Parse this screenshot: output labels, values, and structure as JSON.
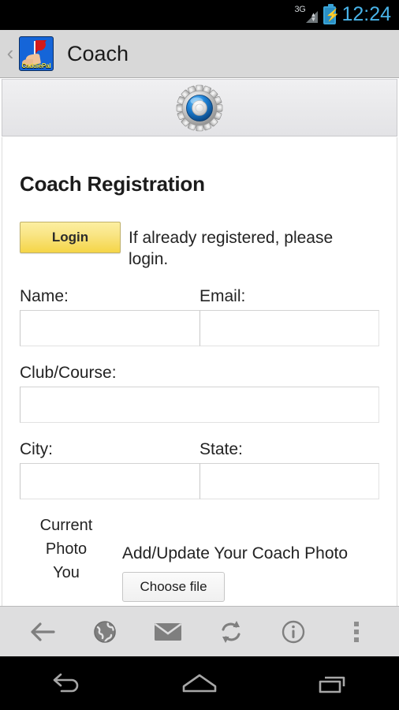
{
  "status_bar": {
    "network_label": "3G",
    "clock": "12:24",
    "battery_state": "charging",
    "clock_color": "#49b3e8"
  },
  "title_bar": {
    "back_chevron": "‹",
    "app_icon_name": "caddiepal-app-icon",
    "app_icon_caption": "CaddiePal",
    "title": "Coach"
  },
  "page_header": {
    "icon_name": "gear-icon"
  },
  "page": {
    "title": "Coach Registration",
    "login_button_label": "Login",
    "login_note": "If already registered, please login.",
    "fields": [
      {
        "label": "Name:",
        "value": "",
        "placeholder": "",
        "width": "half"
      },
      {
        "label": "Email:",
        "value": "",
        "placeholder": "",
        "width": "half"
      },
      {
        "label": "Club/Course:",
        "value": "",
        "placeholder": "",
        "width": "full"
      },
      {
        "label": "City:",
        "value": "",
        "placeholder": "",
        "width": "half"
      },
      {
        "label": "State:",
        "value": "",
        "placeholder": "",
        "width": "half"
      }
    ],
    "photo": {
      "current_photo_label_line1": "Current",
      "current_photo_label_line2": "Photo",
      "current_photo_value": "You",
      "add_update_heading": "Add/Update Your Coach Photo",
      "choose_file_label": "Choose file"
    }
  },
  "browser_toolbar": {
    "buttons": [
      {
        "name": "back-arrow-icon",
        "label": "Back"
      },
      {
        "name": "globe-icon",
        "label": "Bookmarks"
      },
      {
        "name": "envelope-icon",
        "label": "Mail"
      },
      {
        "name": "refresh-icon",
        "label": "Refresh"
      },
      {
        "name": "info-icon",
        "label": "Info"
      },
      {
        "name": "overflow-menu-icon",
        "label": "More"
      }
    ]
  },
  "nav_bar": {
    "buttons": [
      {
        "name": "android-back-icon",
        "label": "Back"
      },
      {
        "name": "android-home-icon",
        "label": "Home"
      },
      {
        "name": "android-recents-icon",
        "label": "Recents"
      }
    ]
  }
}
